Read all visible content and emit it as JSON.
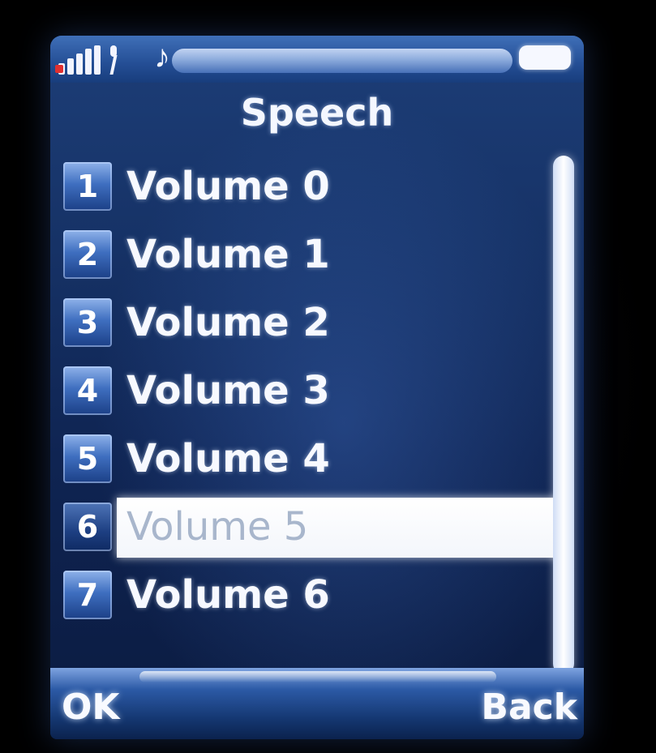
{
  "status_bar": {
    "signal_icon": "signal-strength-icon",
    "antenna_icon": "antenna-icon",
    "ringtone_icon": "music-note-icon",
    "note_glyph": "♪",
    "battery_icon": "battery-icon"
  },
  "screen": {
    "title": "Speech"
  },
  "list": {
    "items": [
      {
        "number": "1",
        "label": "Volume 0"
      },
      {
        "number": "2",
        "label": "Volume 1"
      },
      {
        "number": "3",
        "label": "Volume 2"
      },
      {
        "number": "4",
        "label": "Volume 3"
      },
      {
        "number": "5",
        "label": "Volume 4"
      },
      {
        "number": "6",
        "label": "Volume 5"
      },
      {
        "number": "7",
        "label": "Volume 6"
      }
    ],
    "selected_index": 5
  },
  "softkeys": {
    "left": "OK",
    "right": "Back"
  },
  "colors": {
    "background": "#163266",
    "selection": "#ffffff",
    "text": "#f7f9ff"
  }
}
